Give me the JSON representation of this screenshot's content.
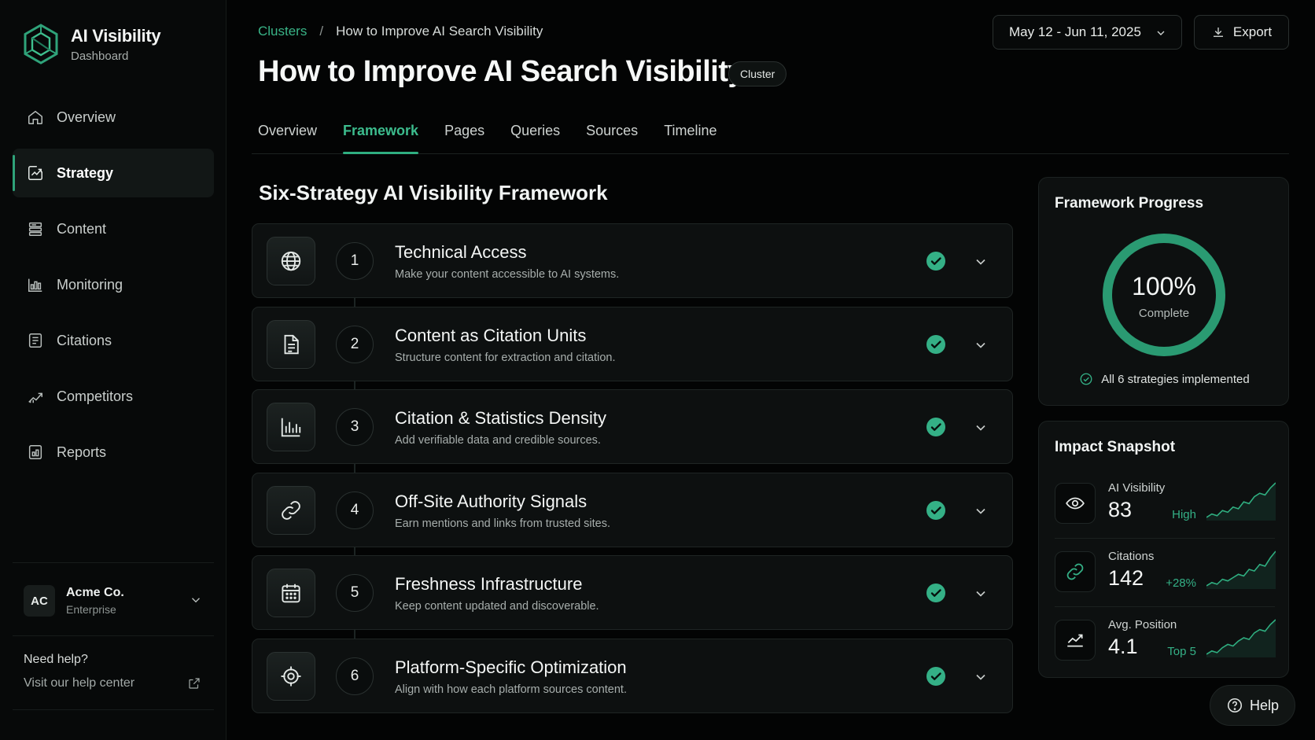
{
  "brand": {
    "title": "AI Visibility",
    "subtitle": "Dashboard"
  },
  "sidebar": {
    "items": [
      {
        "label": "Overview",
        "icon": "home-icon",
        "active": false
      },
      {
        "label": "Strategy",
        "icon": "strategy-icon",
        "active": true
      },
      {
        "label": "Content",
        "icon": "content-icon",
        "active": false
      },
      {
        "label": "Monitoring",
        "icon": "monitoring-icon",
        "active": false
      },
      {
        "label": "Citations",
        "icon": "citations-icon",
        "active": false
      },
      {
        "label": "Competitors",
        "icon": "competitors-icon",
        "active": false
      },
      {
        "label": "Reports",
        "icon": "reports-icon",
        "active": false
      }
    ],
    "account": {
      "initials": "AC",
      "name": "Acme Co.",
      "plan": "Enterprise"
    },
    "help": {
      "title": "Need help?",
      "link": "Visit our help center"
    }
  },
  "header": {
    "breadcrumb": {
      "parent": "Clusters",
      "separator": "/",
      "current": "How to Improve AI Search Visibility"
    },
    "title": "How to Improve AI Search Visibility",
    "badge": "Cluster",
    "date_range": "May 12 - Jun 11, 2025",
    "export_label": "Export"
  },
  "tabs": [
    {
      "label": "Overview",
      "active": false
    },
    {
      "label": "Framework",
      "active": true
    },
    {
      "label": "Pages",
      "active": false
    },
    {
      "label": "Queries",
      "active": false
    },
    {
      "label": "Sources",
      "active": false
    },
    {
      "label": "Timeline",
      "active": false
    }
  ],
  "framework": {
    "title": "Six-Strategy AI Visibility Framework",
    "strategies": [
      {
        "number": "1",
        "title": "Technical Access",
        "description": "Make your content accessible to AI systems.",
        "icon": "globe-icon",
        "complete": true
      },
      {
        "number": "2",
        "title": "Content as Citation Units",
        "description": "Structure content for extraction and citation.",
        "icon": "document-icon",
        "complete": true
      },
      {
        "number": "3",
        "title": "Citation & Statistics Density",
        "description": "Add verifiable data and credible sources.",
        "icon": "bar-chart-icon",
        "complete": true
      },
      {
        "number": "4",
        "title": "Off-Site Authority Signals",
        "description": "Earn mentions and links from trusted sites.",
        "icon": "link-icon",
        "complete": true
      },
      {
        "number": "5",
        "title": "Freshness Infrastructure",
        "description": "Keep content updated and discoverable.",
        "icon": "calendar-icon",
        "complete": true
      },
      {
        "number": "6",
        "title": "Platform-Specific Optimization",
        "description": "Align with how each platform sources content.",
        "icon": "target-icon",
        "complete": true
      }
    ]
  },
  "progress": {
    "title": "Framework Progress",
    "value": "100%",
    "percent": 100,
    "label": "Complete",
    "note": "All 6 strategies implemented"
  },
  "impact": {
    "title": "Impact Snapshot",
    "metrics": [
      {
        "label": "AI Visibility",
        "value": "83",
        "tag": "High",
        "icon": "eye-icon",
        "trend": [
          8,
          10,
          9,
          12,
          11,
          14,
          13,
          17,
          16,
          20,
          22,
          21,
          25,
          28
        ]
      },
      {
        "label": "Citations",
        "value": "142",
        "tag": "+28%",
        "icon": "link-icon",
        "trend": [
          6,
          8,
          7,
          10,
          9,
          11,
          13,
          12,
          16,
          15,
          19,
          18,
          23,
          27
        ]
      },
      {
        "label": "Avg. Position",
        "value": "4.1",
        "tag": "Top 5",
        "icon": "trend-chart-icon",
        "trend": [
          4,
          6,
          5,
          8,
          10,
          9,
          12,
          14,
          13,
          17,
          19,
          18,
          22,
          25
        ]
      }
    ]
  },
  "help_button": "Help",
  "colors": {
    "accent": "#2fae80",
    "background": "#030404",
    "panel": "#0d1010"
  }
}
